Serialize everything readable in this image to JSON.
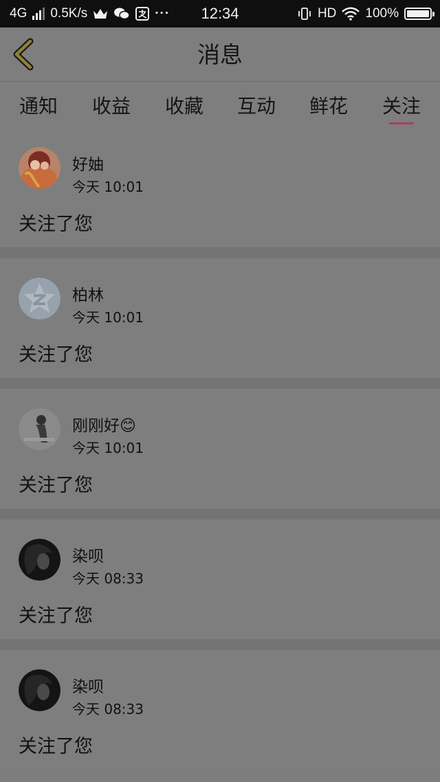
{
  "status_bar": {
    "network": "4G",
    "speed": "0.5K/s",
    "time": "12:34",
    "hd": "HD",
    "battery": "100%",
    "icons": [
      "crown-icon",
      "wechat-icon",
      "alipay-icon",
      "more-dots-icon",
      "vibrate-icon",
      "wifi-icon",
      "battery-icon"
    ]
  },
  "header": {
    "title": "消息",
    "back_icon": "chevron-left-icon",
    "accent_color": "#a63f5e"
  },
  "tabs": [
    {
      "label": "通知"
    },
    {
      "label": "收益"
    },
    {
      "label": "收藏"
    },
    {
      "label": "互动"
    },
    {
      "label": "鲜花"
    },
    {
      "label": "关注",
      "selected": true
    }
  ],
  "messages": [
    {
      "name": "好妯",
      "time": "今天 10:01",
      "action": "关注了您"
    },
    {
      "name": "柏林",
      "time": "今天 10:01",
      "action": "关注了您"
    },
    {
      "name": "刚刚好😊",
      "time": "今天 10:01",
      "action": "关注了您"
    },
    {
      "name": "染呗",
      "time": "今天 08:33",
      "action": "关注了您"
    },
    {
      "name": "染呗",
      "time": "今天 08:33",
      "action": "关注了您"
    }
  ]
}
